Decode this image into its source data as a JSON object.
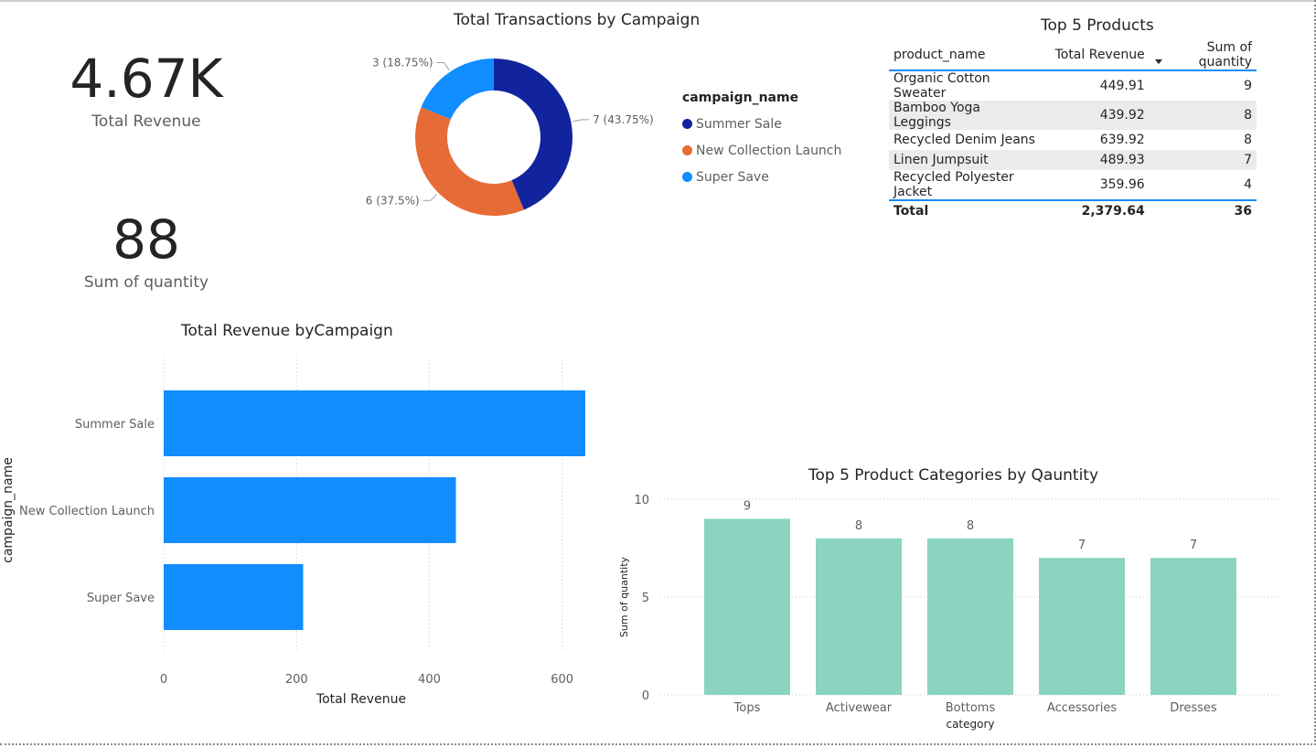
{
  "kpis": {
    "revenue": {
      "value": "4.67K",
      "label": "Total Revenue"
    },
    "quantity": {
      "value": "88",
      "label": "Sum of quantity"
    }
  },
  "donut": {
    "title": "Total Transactions by Campaign",
    "legend_title": "campaign_name",
    "slices": [
      {
        "name": "Summer Sale",
        "value": 7,
        "label": "7 (43.75%)",
        "color": "#12239e"
      },
      {
        "name": "New Collection Launch",
        "value": 6,
        "label": "6 (37.5%)",
        "color": "#e66c37"
      },
      {
        "name": "Super Save",
        "value": 3,
        "label": "3 (18.75%)",
        "color": "#118dff"
      }
    ]
  },
  "products": {
    "title": "Top 5 Products",
    "columns": [
      "product_name",
      "Total Revenue",
      "Sum of quantity"
    ],
    "rows": [
      {
        "name": "Organic Cotton Sweater",
        "revenue": "449.91",
        "qty": "9"
      },
      {
        "name": "Bamboo Yoga Leggings",
        "revenue": "439.92",
        "qty": "8"
      },
      {
        "name": "Recycled Denim Jeans",
        "revenue": "639.92",
        "qty": "8"
      },
      {
        "name": "Linen Jumpsuit",
        "revenue": "489.93",
        "qty": "7"
      },
      {
        "name": "Recycled Polyester Jacket",
        "revenue": "359.96",
        "qty": "4"
      }
    ],
    "total": {
      "label": "Total",
      "revenue": "2,379.64",
      "qty": "36"
    }
  },
  "chart_data": [
    {
      "type": "pie",
      "title": "Total Transactions by Campaign",
      "categories": [
        "Summer Sale",
        "New Collection Launch",
        "Super Save"
      ],
      "values": [
        7,
        6,
        3
      ],
      "data_labels": [
        "7 (43.75%)",
        "6 (37.5%)",
        "3 (18.75%)"
      ],
      "legend_title": "campaign_name",
      "legend": "right",
      "colors": [
        "#12239e",
        "#e66c37",
        "#118dff"
      ]
    },
    {
      "type": "bar",
      "orientation": "horizontal",
      "title": "Total Revenue byCampaign",
      "categories": [
        "Summer Sale",
        "New Collection Launch",
        "Super Save"
      ],
      "values": [
        640,
        440,
        210
      ],
      "xlabel": "Total Revenue",
      "ylabel": "campaign_name",
      "xlim": [
        0,
        650
      ],
      "xticks": [
        "0",
        "200",
        "400",
        "600"
      ],
      "grid": true,
      "color": "#118dff"
    },
    {
      "type": "bar",
      "title": "Top 5 Product Categories by Qauntity",
      "categories": [
        "Tops",
        "Activewear",
        "Bottoms",
        "Accessories",
        "Dresses"
      ],
      "values": [
        9,
        8,
        8,
        7,
        7
      ],
      "data_labels": [
        "9",
        "8",
        "8",
        "7",
        "7"
      ],
      "xlabel": "category",
      "ylabel": "Sum of quantity",
      "ylim": [
        0,
        10
      ],
      "yticks": [
        "0",
        "5",
        "10"
      ],
      "grid": true,
      "color": "#8ad4c1"
    }
  ]
}
